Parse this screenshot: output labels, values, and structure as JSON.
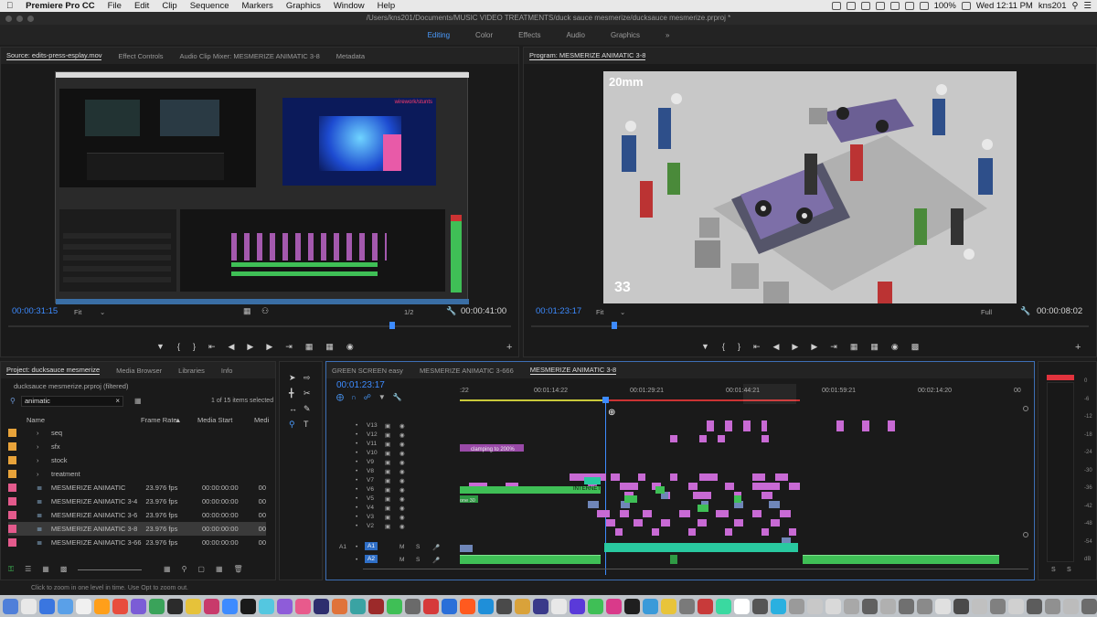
{
  "menubar": {
    "app": "Premiere Pro CC",
    "items": [
      "File",
      "Edit",
      "Clip",
      "Sequence",
      "Markers",
      "Graphics",
      "Window",
      "Help"
    ],
    "battery": "100%",
    "clock": "Wed 12:11 PM",
    "user": "kns201"
  },
  "title_path": "/Users/kns201/Documents/MUSIC VIDEO TREATMENTS/duck sauce mesmerize/ducksauce mesmerize.prproj *",
  "workspaces": [
    {
      "label": "Editing",
      "active": true
    },
    {
      "label": "Color",
      "active": false
    },
    {
      "label": "Effects",
      "active": false
    },
    {
      "label": "Audio",
      "active": false
    },
    {
      "label": "Graphics",
      "active": false
    }
  ],
  "source_panel": {
    "tabs": [
      "Source: edits-press-esplay.mov",
      "Effect Controls",
      "Audio Clip Mixer: MESMERIZE ANIMATIC 3-8",
      "Metadata"
    ],
    "timecode": "00:00:31:15",
    "fit": "Fit",
    "ratio": "1/2",
    "duration": "00:00:41:00"
  },
  "program_panel": {
    "tab": "Program: MESMERIZE ANIMATIC 3-8",
    "overlay_top": "20mm",
    "overlay_bottom": "33",
    "timecode": "00:01:23:17",
    "fit": "Fit",
    "quality": "Full",
    "duration": "00:00:08:02"
  },
  "project_panel": {
    "tabs": [
      "Project: ducksauce mesmerize",
      "Media Browser",
      "Libraries",
      "Info"
    ],
    "filename": "ducksauce mesmerize.prproj (filtered)",
    "search": "animatic",
    "count": "1 of 15 items selected",
    "columns": [
      "Name",
      "Frame Rate",
      "Media Start",
      "Medi"
    ],
    "rows": [
      {
        "name": "seq",
        "fps": "",
        "start": "",
        "media": "",
        "color": "orange",
        "type": "folder"
      },
      {
        "name": "sfx",
        "fps": "",
        "start": "",
        "media": "",
        "color": "orange",
        "type": "folder"
      },
      {
        "name": "stock",
        "fps": "",
        "start": "",
        "media": "",
        "color": "orange",
        "type": "folder"
      },
      {
        "name": "treatment",
        "fps": "",
        "start": "",
        "media": "",
        "color": "orange",
        "type": "folder"
      },
      {
        "name": "MESMERIZE ANIMATIC",
        "fps": "23.976 fps",
        "start": "00:00:00:00",
        "media": "00",
        "color": "pink",
        "type": "seq"
      },
      {
        "name": "MESMERIZE ANIMATIC 3-4",
        "fps": "23.976 fps",
        "start": "00:00:00:00",
        "media": "00",
        "color": "pink",
        "type": "seq"
      },
      {
        "name": "MESMERIZE ANIMATIC 3-6",
        "fps": "23.976 fps",
        "start": "00:00:00:00",
        "media": "00",
        "color": "pink",
        "type": "seq"
      },
      {
        "name": "MESMERIZE ANIMATIC 3-8",
        "fps": "23.976 fps",
        "start": "00:00:00:00",
        "media": "00",
        "color": "pink",
        "type": "seq",
        "selected": true
      },
      {
        "name": "MESMERIZE ANIMATIC 3-66",
        "fps": "23.976 fps",
        "start": "00:00:00:00",
        "media": "00",
        "color": "pink",
        "type": "seq"
      }
    ]
  },
  "timeline": {
    "tabs": [
      "GREEN SCREEN easy",
      "MESMERIZE ANIMATIC 3-666",
      "MESMERIZE ANIMATIC 3-8"
    ],
    "timecode": "00:01:23:17",
    "ruler": [
      ":22",
      "00:01:14:22",
      "00:01:29:21",
      "00:01:44:21",
      "00:01:59:21",
      "00:02:14:20",
      "00"
    ],
    "video_tracks": [
      "V13",
      "V12",
      "V11",
      "V10",
      "V9",
      "V8",
      "V7",
      "V6",
      "V5",
      "V4",
      "V3",
      "V2"
    ],
    "audio_tracks": [
      "A1",
      "A2"
    ],
    "clip_labels": [
      "clamping to 200%",
      "INTERNET",
      "INTE",
      "one 30"
    ]
  },
  "meter": {
    "scale": [
      "0",
      "-6",
      "-12",
      "-18",
      "-24",
      "-30",
      "-36",
      "-42",
      "-48",
      "-54",
      "dB"
    ],
    "solo": [
      "S",
      "S"
    ]
  },
  "status_text": "Click to zoom in one level in time. Use Opt to zoom out."
}
